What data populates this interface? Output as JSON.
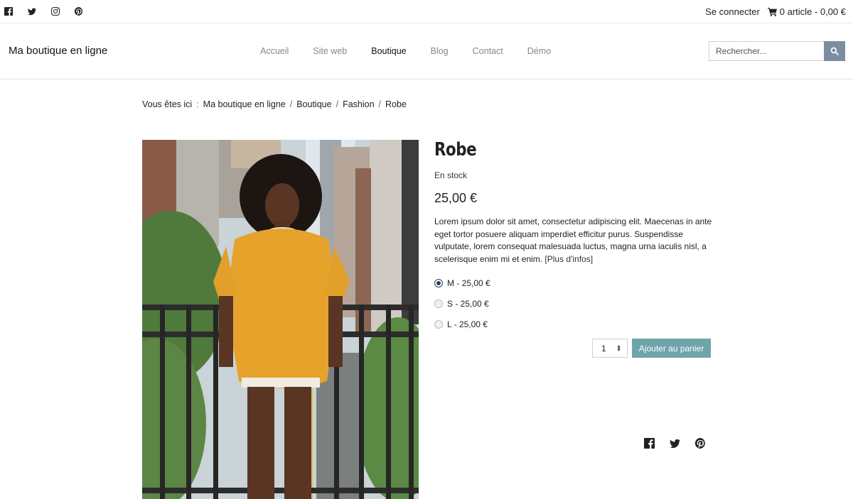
{
  "topbar": {
    "social": [
      {
        "icon": "facebook-icon"
      },
      {
        "icon": "twitter-icon"
      },
      {
        "icon": "instagram-icon"
      },
      {
        "icon": "pinterest-icon"
      }
    ],
    "login_label": "Se connecter",
    "cart_label": "0 article - 0,00 €"
  },
  "header": {
    "brand": "Ma boutique en ligne",
    "nav": [
      {
        "label": "Accueil",
        "active": false
      },
      {
        "label": "Site web",
        "active": false
      },
      {
        "label": "Boutique",
        "active": true
      },
      {
        "label": "Blog",
        "active": false
      },
      {
        "label": "Contact",
        "active": false
      },
      {
        "label": "Démo",
        "active": false
      }
    ],
    "search": {
      "placeholder": "Rechercher...",
      "button_icon": "search-icon",
      "button_color": "#7b8ea1"
    }
  },
  "breadcrumb": {
    "label": "Vous êtes ici",
    "separator_label": ":",
    "items": [
      "Ma boutique en ligne",
      "Boutique",
      "Fashion",
      "Robe"
    ]
  },
  "product": {
    "title": "Robe",
    "stock": "En stock",
    "price": "25,00 €",
    "description": "Lorem ipsum dolor sit amet, consectetur adipiscing elit. Maecenas in ante eget tortor posuere aliquam imperdiet efficitur purus. Suspendisse vulputate, lorem consequat malesuada luctus, magna urna iaculis nisl, a scelerisque enim mi et enim.",
    "more_link": "[Plus d'infos]",
    "variants": [
      {
        "label": "M - 25,00 €",
        "checked": true
      },
      {
        "label": "S - 25,00 €",
        "checked": false
      },
      {
        "label": "L - 25,00 €",
        "checked": false
      }
    ],
    "quantity": "1",
    "add_to_cart_label": "Ajouter au panier",
    "add_to_cart_color": "#6fa4ab",
    "share": [
      {
        "icon": "facebook-icon"
      },
      {
        "icon": "twitter-icon"
      },
      {
        "icon": "pinterest-icon"
      }
    ]
  }
}
